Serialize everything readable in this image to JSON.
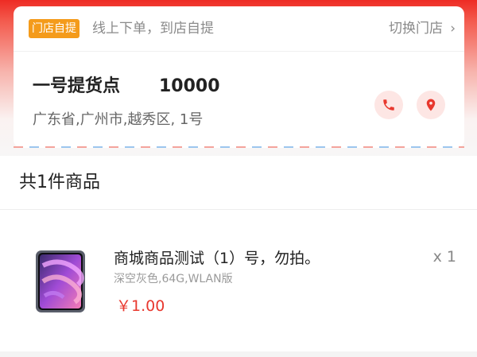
{
  "pickup": {
    "badge": "门店自提",
    "description": "线上下单，到店自提",
    "switch_label": "切换门店",
    "switch_chevron": "›"
  },
  "store": {
    "name": "一号提货点",
    "phone": "10000",
    "address": "广东省,广州市,越秀区, 1号",
    "call_icon": "phone-icon",
    "location_icon": "location-pin-icon"
  },
  "goods": {
    "count_label": "共1件商品",
    "items": [
      {
        "title": "商城商品测试（1）号，勿拍。",
        "spec": "深空灰色,64G,WLAN版",
        "price": "￥1.00",
        "quantity": "x 1",
        "image_icon": "tablet-product-image"
      }
    ]
  },
  "colors": {
    "accent_red": "#e8382e",
    "badge_orange": "#f49b1b",
    "icon_bg": "#fde6e4"
  }
}
